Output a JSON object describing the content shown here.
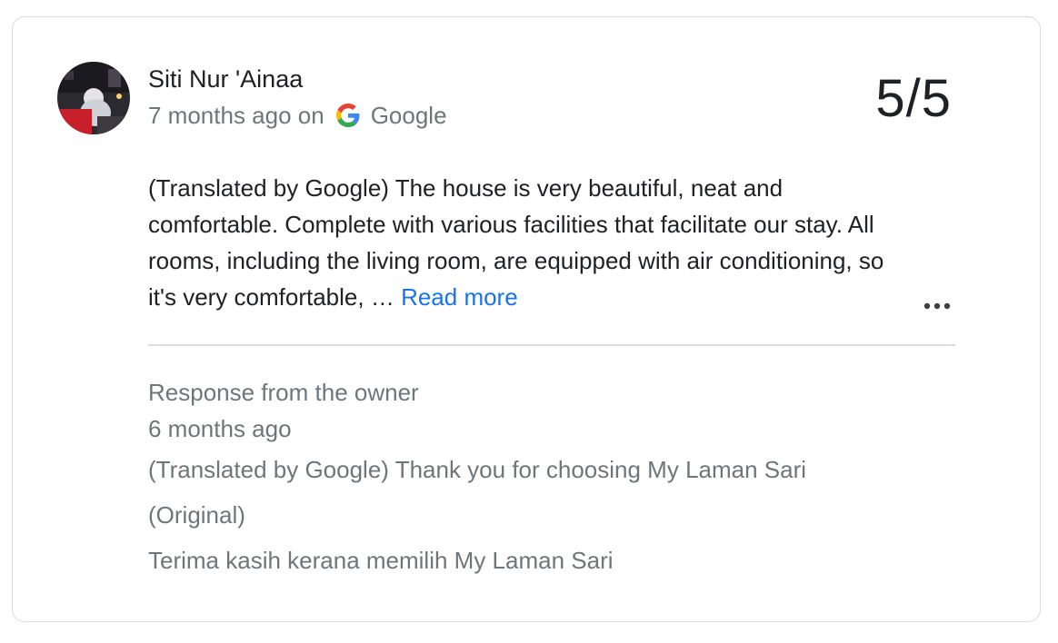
{
  "review": {
    "reviewer_name": "Siti Nur 'Ainaa",
    "time_ago": "7 months ago on",
    "source": "Google",
    "rating": "5/5",
    "text": "(Translated by Google) The house is very beautiful, neat and comfortable. Complete with various facilities that facilitate our stay. All rooms, including the living room, are equipped with air conditioning, so it's very comfortable, …",
    "read_more_label": "Read more",
    "icons": {
      "avatar": "avatar",
      "source": "google-icon",
      "menu": "more-options-icon"
    }
  },
  "owner_response": {
    "heading": "Response from the owner",
    "time_ago": "6 months ago",
    "translated": "(Translated by Google) Thank you for choosing My Laman Sari",
    "original_label": "(Original)",
    "original": "Terima kasih kerana memilih My Laman Sari"
  },
  "colors": {
    "link": "#1a73e8",
    "primary_text": "#202124",
    "secondary_text": "#70757a",
    "border": "#dadce0"
  }
}
